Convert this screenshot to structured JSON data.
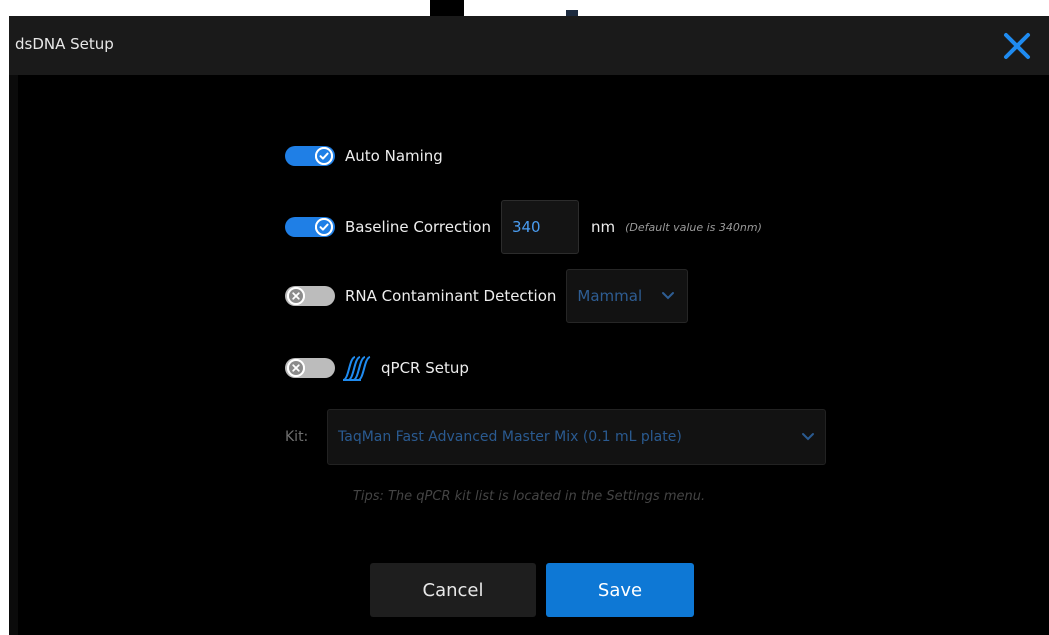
{
  "dialog": {
    "title": "dsDNA Setup"
  },
  "settings": {
    "auto_naming": {
      "label": "Auto Naming",
      "enabled": true
    },
    "baseline_correction": {
      "label": "Baseline Correction",
      "enabled": true,
      "value": "340",
      "unit": "nm",
      "hint": "(Default value is 340nm)"
    },
    "rna_contaminant": {
      "label": "RNA Contaminant Detection",
      "enabled": false,
      "selected": "Mammal"
    },
    "qpcr": {
      "label": "qPCR Setup",
      "enabled": false
    }
  },
  "kit": {
    "label": "Kit:",
    "selected": "TaqMan Fast Advanced Master Mix (0.1 mL plate)",
    "tips": "Tips: The qPCR kit list is located in the Settings menu."
  },
  "buttons": {
    "cancel": "Cancel",
    "save": "Save"
  },
  "colors": {
    "accent": "#1f7fe6",
    "save": "#0e78d5",
    "background": "#000000"
  }
}
